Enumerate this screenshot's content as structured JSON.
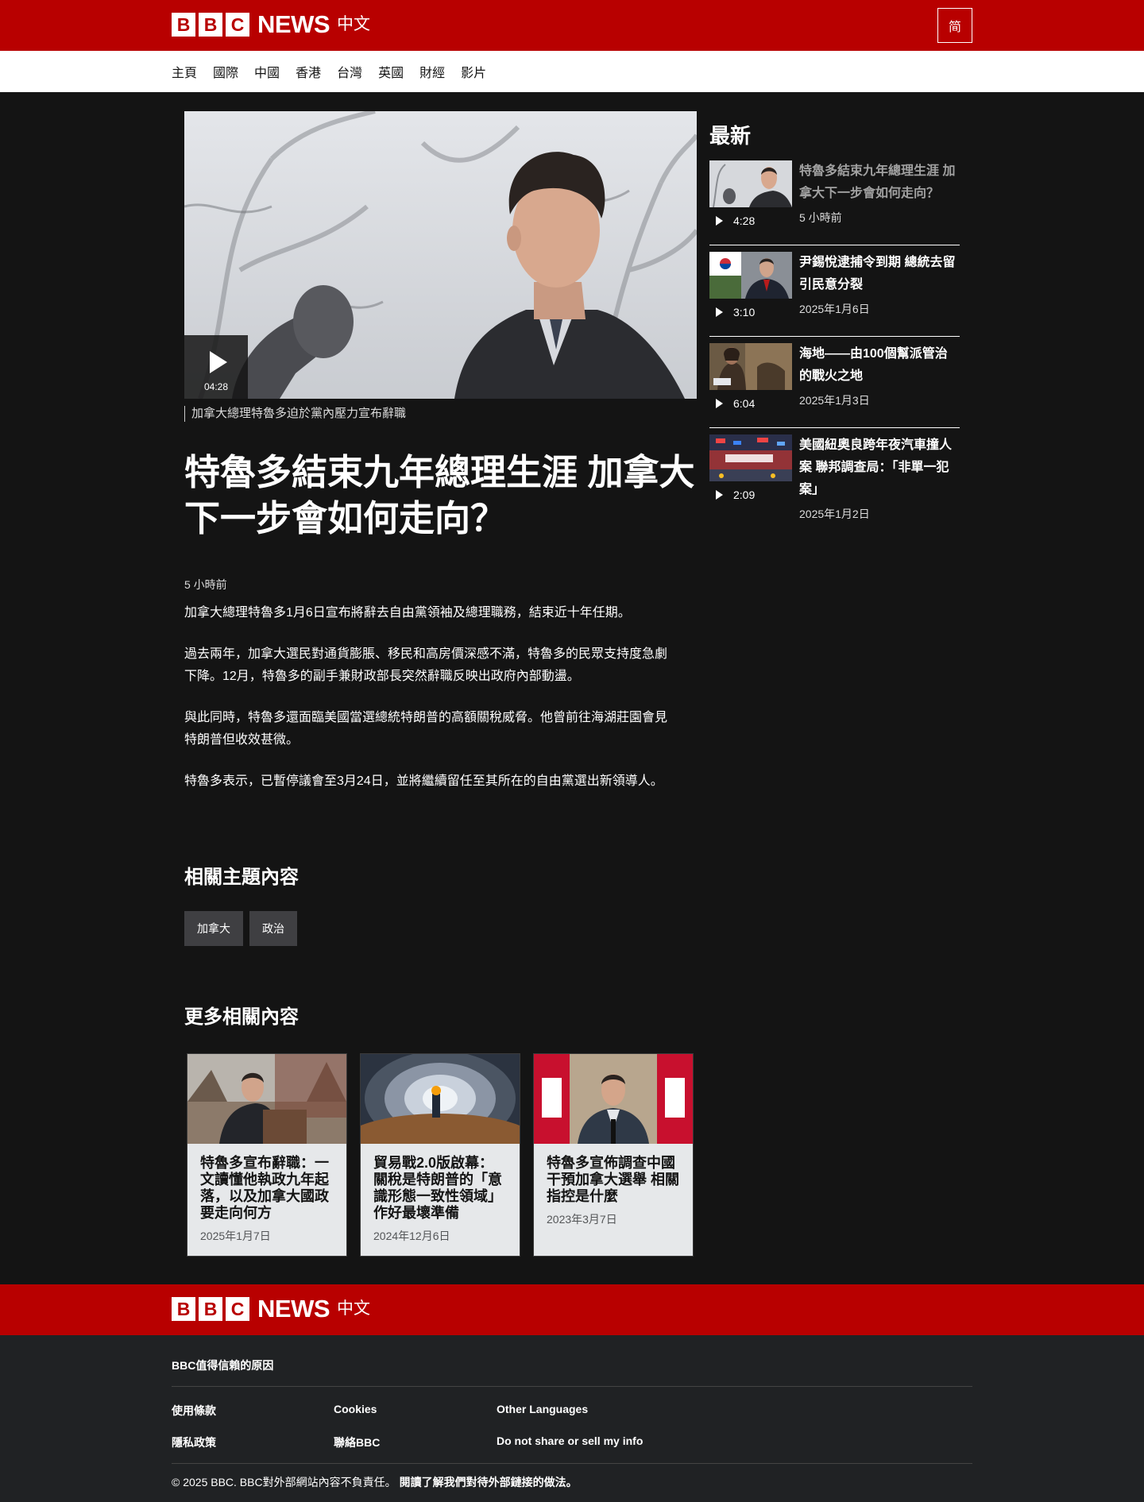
{
  "header": {
    "brand_block_1": "B",
    "brand_block_2": "B",
    "brand_block_3": "C",
    "brand_news": "NEWS",
    "brand_lang": "中文",
    "script_toggle": "简"
  },
  "nav": {
    "items": [
      "主頁",
      "國際",
      "中國",
      "香港",
      "台灣",
      "英國",
      "財經",
      "影片"
    ]
  },
  "video": {
    "duration": "04:28",
    "caption": "加拿大總理特魯多迫於黨內壓力宣布辭職"
  },
  "article": {
    "headline": "特魯多結束九年總理生涯 加拿大下一步會如何走向？",
    "time_ago": "5 小時前",
    "paragraphs": [
      "加拿大總理特魯多1月6日宣布將辭去自由黨領袖及總理職務，結束近十年任期。",
      "過去兩年，加拿大選民對通貨膨脹、移民和高房價深感不滿，特魯多的民眾支持度急劇下降。12月，特魯多的副手兼財政部長突然辭職反映出政府內部動盪。",
      "與此同時，特魯多還面臨美國當選總統特朗普的高額關稅威脅。他曾前往海湖莊園會見特朗普但收效甚微。",
      "特魯多表示，已暫停議會至3月24日，並將繼續留任至其所在的自由黨選出新領導人。"
    ]
  },
  "topics": {
    "heading": "相關主題內容",
    "tags": [
      "加拿大",
      "政治"
    ]
  },
  "related": {
    "heading": "更多相關內容",
    "cards": [
      {
        "title": "特魯多宣布辭職：一文讀懂他執政九年起落，以及加拿大國政要走向何方",
        "date": "2025年1月7日"
      },
      {
        "title": "貿易戰2.0版啟幕：關稅是特朗普的「意識形態一致性領域」作好最壞準備",
        "date": "2024年12月6日"
      },
      {
        "title": "特魯多宣佈調查中國干預加拿大選舉 相關指控是什麼",
        "date": "2023年3月7日"
      }
    ]
  },
  "sidebar": {
    "heading": "最新",
    "items": [
      {
        "title": "特魯多結束九年總理生涯 加拿大下一步會如何走向？",
        "duration": "4:28",
        "date": "5 小時前"
      },
      {
        "title": "尹錫悅逮捕令到期 總統去留引民意分裂",
        "duration": "3:10",
        "date": "2025年1月6日"
      },
      {
        "title": "海地——由100個幫派管治的戰火之地",
        "duration": "6:04",
        "date": "2025年1月3日"
      },
      {
        "title": "美國紐奧良跨年夜汽車撞人案 聯邦調查局：「非單一犯案」",
        "duration": "2:09",
        "date": "2025年1月2日"
      }
    ]
  },
  "footer": {
    "why_trust": "BBC值得信賴的原因",
    "terms": "使用條款",
    "cookies": "Cookies",
    "other_languages": "Other Languages",
    "privacy": "隱私政策",
    "contact": "聯絡BBC",
    "do_not_share": "Do not share or sell my info",
    "copyright": "© 2025 BBC. BBC對外部網站內容不負責任。",
    "external_link_policy": "閱讀了解我們對待外部鏈接的做法。"
  },
  "colors": {
    "brand_red": "#b80000",
    "page_bg": "#141414",
    "footer_bg": "#202224"
  }
}
